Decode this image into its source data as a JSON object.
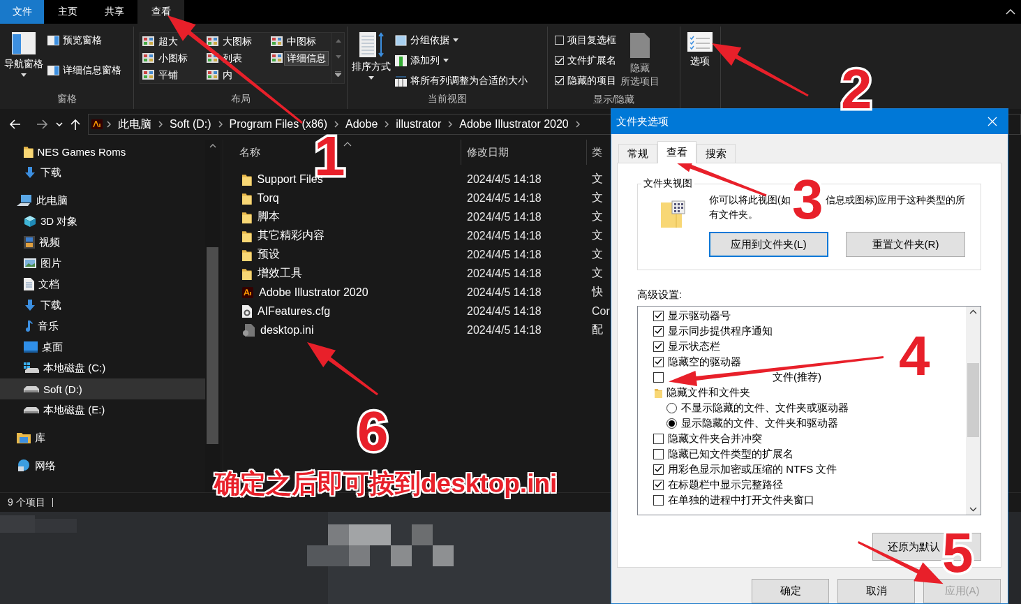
{
  "ribbon_tabs": [
    {
      "label": "文件",
      "kind": "file",
      "selected": false
    },
    {
      "label": "主页",
      "kind": "tab",
      "selected": false
    },
    {
      "label": "共享",
      "kind": "tab",
      "selected": false
    },
    {
      "label": "查看",
      "kind": "tab",
      "selected": true
    }
  ],
  "ribbon": {
    "panes": {
      "label": "窗格",
      "navigation": "导航窗格",
      "preview": "预览窗格",
      "details": "详细信息窗格"
    },
    "layout": {
      "label": "布局",
      "options": [
        {
          "label": "超大",
          "selected": false
        },
        {
          "label": "大图标",
          "selected": false
        },
        {
          "label": "中图标",
          "selected": false
        },
        {
          "label": "小图标",
          "selected": false
        },
        {
          "label": "列表",
          "selected": false
        },
        {
          "label": "详细信息",
          "selected": true
        },
        {
          "label": "平铺",
          "selected": false
        },
        {
          "label": "内",
          "selected": false
        }
      ]
    },
    "current_view": {
      "label": "当前视图",
      "sort": "排序方式",
      "group_by": "分组依据",
      "add_column": "添加列",
      "fit_columns": "将所有列调整为合适的大小"
    },
    "show_hide": {
      "label": "显示/隐藏",
      "checkboxes": [
        {
          "label": "项目复选框",
          "checked": false
        },
        {
          "label": "文件扩展名",
          "checked": true
        },
        {
          "label": "隐藏的项目",
          "checked": true
        }
      ],
      "hide_selected": [
        "隐藏",
        "所选项目"
      ]
    },
    "options": {
      "label": "选项"
    }
  },
  "address": {
    "segments": [
      "此电脑",
      "Soft (D:)",
      "Program Files (x86)",
      "Adobe",
      "illustrator",
      "Adobe Illustrator 2020"
    ]
  },
  "navigation": {
    "quick_access": [
      {
        "label": "NES Games Roms",
        "kind": "folder",
        "selected": false
      },
      {
        "label": "下载",
        "kind": "download",
        "selected": false
      }
    ],
    "tree": [
      {
        "label": "此电脑",
        "kind": "pc",
        "selected": false,
        "children": [
          {
            "label": "3D 对象",
            "kind": "cube",
            "selected": false
          },
          {
            "label": "视频",
            "kind": "video",
            "selected": false
          },
          {
            "label": "图片",
            "kind": "picture",
            "selected": false
          },
          {
            "label": "文档",
            "kind": "document",
            "selected": false
          },
          {
            "label": "下载",
            "kind": "download",
            "selected": false
          },
          {
            "label": "音乐",
            "kind": "music",
            "selected": false
          },
          {
            "label": "桌面",
            "kind": "desktop",
            "selected": false
          },
          {
            "label": "本地磁盘 (C:)",
            "kind": "system-drive",
            "selected": false
          },
          {
            "label": "Soft (D:)",
            "kind": "drive",
            "selected": true
          },
          {
            "label": "本地磁盘 (E:)",
            "kind": "drive",
            "selected": false
          }
        ]
      },
      {
        "label": "库",
        "kind": "library",
        "selected": false
      },
      {
        "label": "网络",
        "kind": "network",
        "selected": false
      }
    ]
  },
  "file_list": {
    "columns": [
      "名称",
      "修改日期",
      "类"
    ],
    "rows": [
      {
        "name": "Support Files",
        "kind": "folder",
        "modified": "2024/4/5 14:18",
        "type": "文"
      },
      {
        "name": "Torq",
        "kind": "folder",
        "modified": "2024/4/5 14:18",
        "type": "文"
      },
      {
        "name": "脚本",
        "kind": "folder",
        "modified": "2024/4/5 14:18",
        "type": "文"
      },
      {
        "name": "其它精彩内容",
        "kind": "folder",
        "modified": "2024/4/5 14:18",
        "type": "文"
      },
      {
        "name": "预设",
        "kind": "folder",
        "modified": "2024/4/5 14:18",
        "type": "文"
      },
      {
        "name": "增效工具",
        "kind": "folder",
        "modified": "2024/4/5 14:18",
        "type": "文"
      },
      {
        "name": "Adobe Illustrator 2020",
        "kind": "app",
        "modified": "2024/4/5 14:18",
        "type": "快"
      },
      {
        "name": "AIFeatures.cfg",
        "kind": "config",
        "modified": "2024/4/5 14:18",
        "type": "Cor"
      },
      {
        "name": "desktop.ini",
        "kind": "ini",
        "modified": "2024/4/5 14:18",
        "type": "配"
      }
    ]
  },
  "status_bar": {
    "count": "9 个项目"
  },
  "dialog": {
    "title": "文件夹选项",
    "tabs": [
      {
        "label": "常规",
        "selected": false
      },
      {
        "label": "查看",
        "selected": true
      },
      {
        "label": "搜索",
        "selected": false
      }
    ],
    "folder_views": {
      "title": "文件夹视图",
      "description": [
        [
          "你可以将此视图(如",
          "信息或图标)应用于这种类型的所"
        ],
        [
          "有文件夹。"
        ]
      ],
      "buttons": [
        {
          "label": "应用到文件夹(L)",
          "focused": true
        },
        {
          "label": "重置文件夹(R)",
          "focused": false
        }
      ]
    },
    "advanced_label": "高级设置:",
    "settings": [
      {
        "kind": "checkbox",
        "label": "显示驱动器号",
        "checked": true
      },
      {
        "kind": "checkbox",
        "label": "显示同步提供程序通知",
        "checked": true
      },
      {
        "kind": "checkbox",
        "label": "显示状态栏",
        "checked": true
      },
      {
        "kind": "checkbox",
        "label": "隐藏空的驱动器",
        "checked": true
      },
      {
        "kind": "covered-checkbox",
        "label": "文件(推荐)",
        "checked": false
      },
      {
        "kind": "folder",
        "label": "隐藏文件和文件夹"
      },
      {
        "kind": "radio",
        "label": "不显示隐藏的文件、文件夹或驱动器",
        "selected": false
      },
      {
        "kind": "radio",
        "label": "显示隐藏的文件、文件夹和驱动器",
        "selected": true
      },
      {
        "kind": "checkbox",
        "label": "隐藏文件夹合并冲突",
        "checked": false
      },
      {
        "kind": "checkbox",
        "label": "隐藏已知文件类型的扩展名",
        "checked": false
      },
      {
        "kind": "checkbox",
        "label": "用彩色显示加密或压缩的 NTFS 文件",
        "checked": true
      },
      {
        "kind": "checkbox",
        "label": "在标题栏中显示完整路径",
        "checked": true
      },
      {
        "kind": "checkbox",
        "label": "在单独的进程中打开文件夹窗口",
        "checked": false
      }
    ],
    "restore": "还原为默认",
    "footer_buttons": [
      {
        "label": "确定",
        "disabled": false
      },
      {
        "label": "取消",
        "disabled": false
      },
      {
        "label": "应用(A)",
        "disabled": true
      }
    ]
  },
  "annotations": {
    "steps": [
      "1",
      "2",
      "3",
      "4",
      "5",
      "6"
    ],
    "caption": "确定之后即可按到desktop.ini"
  }
}
